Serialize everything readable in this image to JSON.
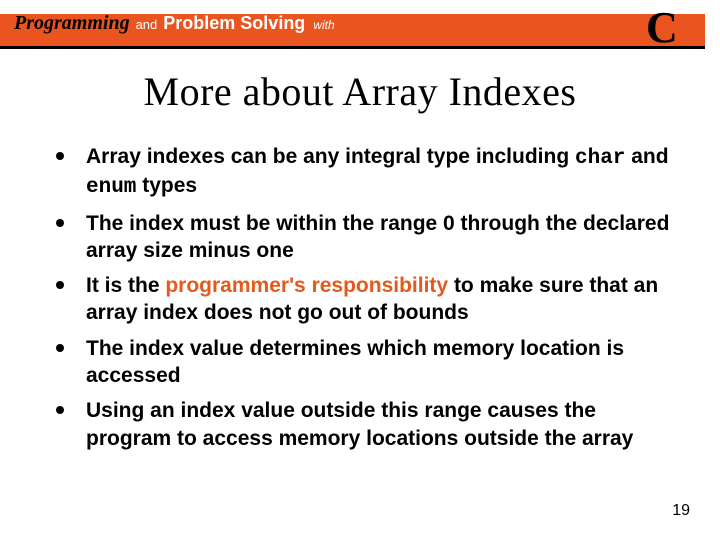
{
  "banner": {
    "brand_prefix": "Programming",
    "brand_and": "and",
    "brand_ps": "Problem Solving",
    "brand_with": "with",
    "lang_letter": "C",
    "lang_plus": "+"
  },
  "heading": "More about Array Indexes",
  "bullets": [
    {
      "pre": "Array indexes can be any integral type including ",
      "code1": "char",
      "mid": " and ",
      "code2": "enum",
      "post": " types"
    },
    {
      "text": "The index must be within the range 0 through the declared array size minus one"
    },
    {
      "pre": "It is the ",
      "accent": "programmer's responsibility",
      "post": " to make sure that an array index does not go out of bounds"
    },
    {
      "text": "The index value determines which memory location is accessed"
    },
    {
      "text": "Using an index value outside this range causes the program to access memory locations outside the array"
    }
  ],
  "page_number": "19",
  "colors": {
    "brand_orange": "#e9541f",
    "accent": "#e35a1c"
  }
}
